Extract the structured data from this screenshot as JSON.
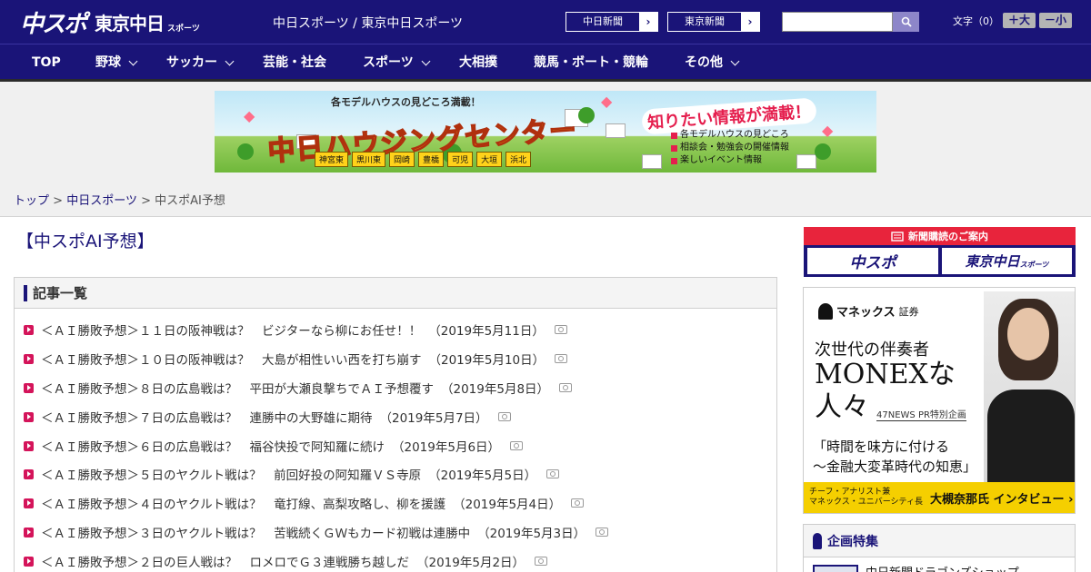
{
  "header": {
    "logo_main": "中スポ",
    "logo_sub": "東京中日",
    "logo_sub_small": "スポーツ",
    "tagline": "中日スポーツ / 東京中日スポーツ",
    "paper_buttons": [
      {
        "label": "中日新聞",
        "arrow": "›"
      },
      {
        "label": "東京新聞",
        "arrow": "›"
      }
    ],
    "search": {
      "placeholder": ""
    },
    "font_size": {
      "label": "文字（0）",
      "bigger": "＋大",
      "smaller": "－小"
    }
  },
  "nav": {
    "items": [
      {
        "label": "TOP",
        "has_dropdown": false
      },
      {
        "label": "野球",
        "has_dropdown": true
      },
      {
        "label": "サッカー",
        "has_dropdown": true
      },
      {
        "label": "芸能・社会",
        "has_dropdown": false
      },
      {
        "label": "スポーツ",
        "has_dropdown": true
      },
      {
        "label": "大相撲",
        "has_dropdown": false
      },
      {
        "label": "競馬・ボート・競輪",
        "has_dropdown": false
      },
      {
        "label": "その他",
        "has_dropdown": true
      }
    ]
  },
  "banner": {
    "top_text": "各モデルハウスの見どころ満載！",
    "title": "中日ハウジングセンター",
    "badge": "知りたい情報が満載！",
    "features": [
      "各モデルハウスの見どころ",
      "相談会・勉強会の開催情報",
      "楽しいイベント情報"
    ],
    "cities": [
      "神宮東",
      "黒川東",
      "岡崎",
      "豊橋",
      "可児",
      "大垣",
      "浜北"
    ]
  },
  "breadcrumb": {
    "items": [
      "トップ",
      "中日スポーツ"
    ],
    "separator": ">",
    "current": "中スポAI予想"
  },
  "main": {
    "page_title": "【中スポAI予想】",
    "list_heading": "記事一覧",
    "articles": [
      {
        "title": "＜ＡＩ勝敗予想＞１１日の阪神戦は？　ビジターなら柳にお任せ！！",
        "date": "（2019年5月11日）"
      },
      {
        "title": "＜ＡＩ勝敗予想＞１０日の阪神戦は？　大島が相性いい西を打ち崩す",
        "date": "（2019年5月10日）"
      },
      {
        "title": "＜ＡＩ勝敗予想＞８日の広島戦は？　平田が大瀬良撃ちでＡＩ予想覆す",
        "date": "（2019年5月8日）"
      },
      {
        "title": "＜ＡＩ勝敗予想＞７日の広島戦は？　連勝中の大野雄に期待",
        "date": "（2019年5月7日）"
      },
      {
        "title": "＜ＡＩ勝敗予想＞６日の広島戦は？　福谷快投で阿知羅に続け",
        "date": "（2019年5月6日）"
      },
      {
        "title": "＜ＡＩ勝敗予想＞５日のヤクルト戦は？　前回好投の阿知羅ＶＳ寺原",
        "date": "（2019年5月5日）"
      },
      {
        "title": "＜ＡＩ勝敗予想＞４日のヤクルト戦は？　竜打線、高梨攻略し、柳を援護",
        "date": "（2019年5月4日）"
      },
      {
        "title": "＜ＡＩ勝敗予想＞３日のヤクルト戦は？　苦戦続くＧＷもカード初戦は連勝中",
        "date": "（2019年5月3日）"
      },
      {
        "title": "＜ＡＩ勝敗予想＞２日の巨人戦は？　ロメロでＧ３連戦勝ち越しだ",
        "date": "（2019年5月2日）"
      }
    ]
  },
  "sidebar": {
    "subscription": {
      "label": "新聞購読のご案内",
      "btn1": "中スポ",
      "btn2": "東京中日",
      "btn2_small": "スポーツ"
    },
    "ad": {
      "brand": "マネックス",
      "brand_suffix": "証券",
      "headline1": "次世代の伴奏者",
      "headline2": "MONEXな",
      "headline3": "人々",
      "tag": "47NEWS PR特別企画",
      "quote1": "「時間を味方に付ける",
      "quote2": "〜金融大変革時代の知恵」",
      "foot_small1": "チーフ・アナリスト兼",
      "foot_small2": "マネックス・ユニバーシティ長",
      "foot_large": "大槻奈那氏 インタビュー ›"
    },
    "feature": {
      "heading": "企画特集",
      "item": "中日新聞ドラゴンズショップ"
    }
  },
  "colors": {
    "brand": "#1a1478",
    "accent": "#d4145a",
    "alert": "#e8243c"
  }
}
